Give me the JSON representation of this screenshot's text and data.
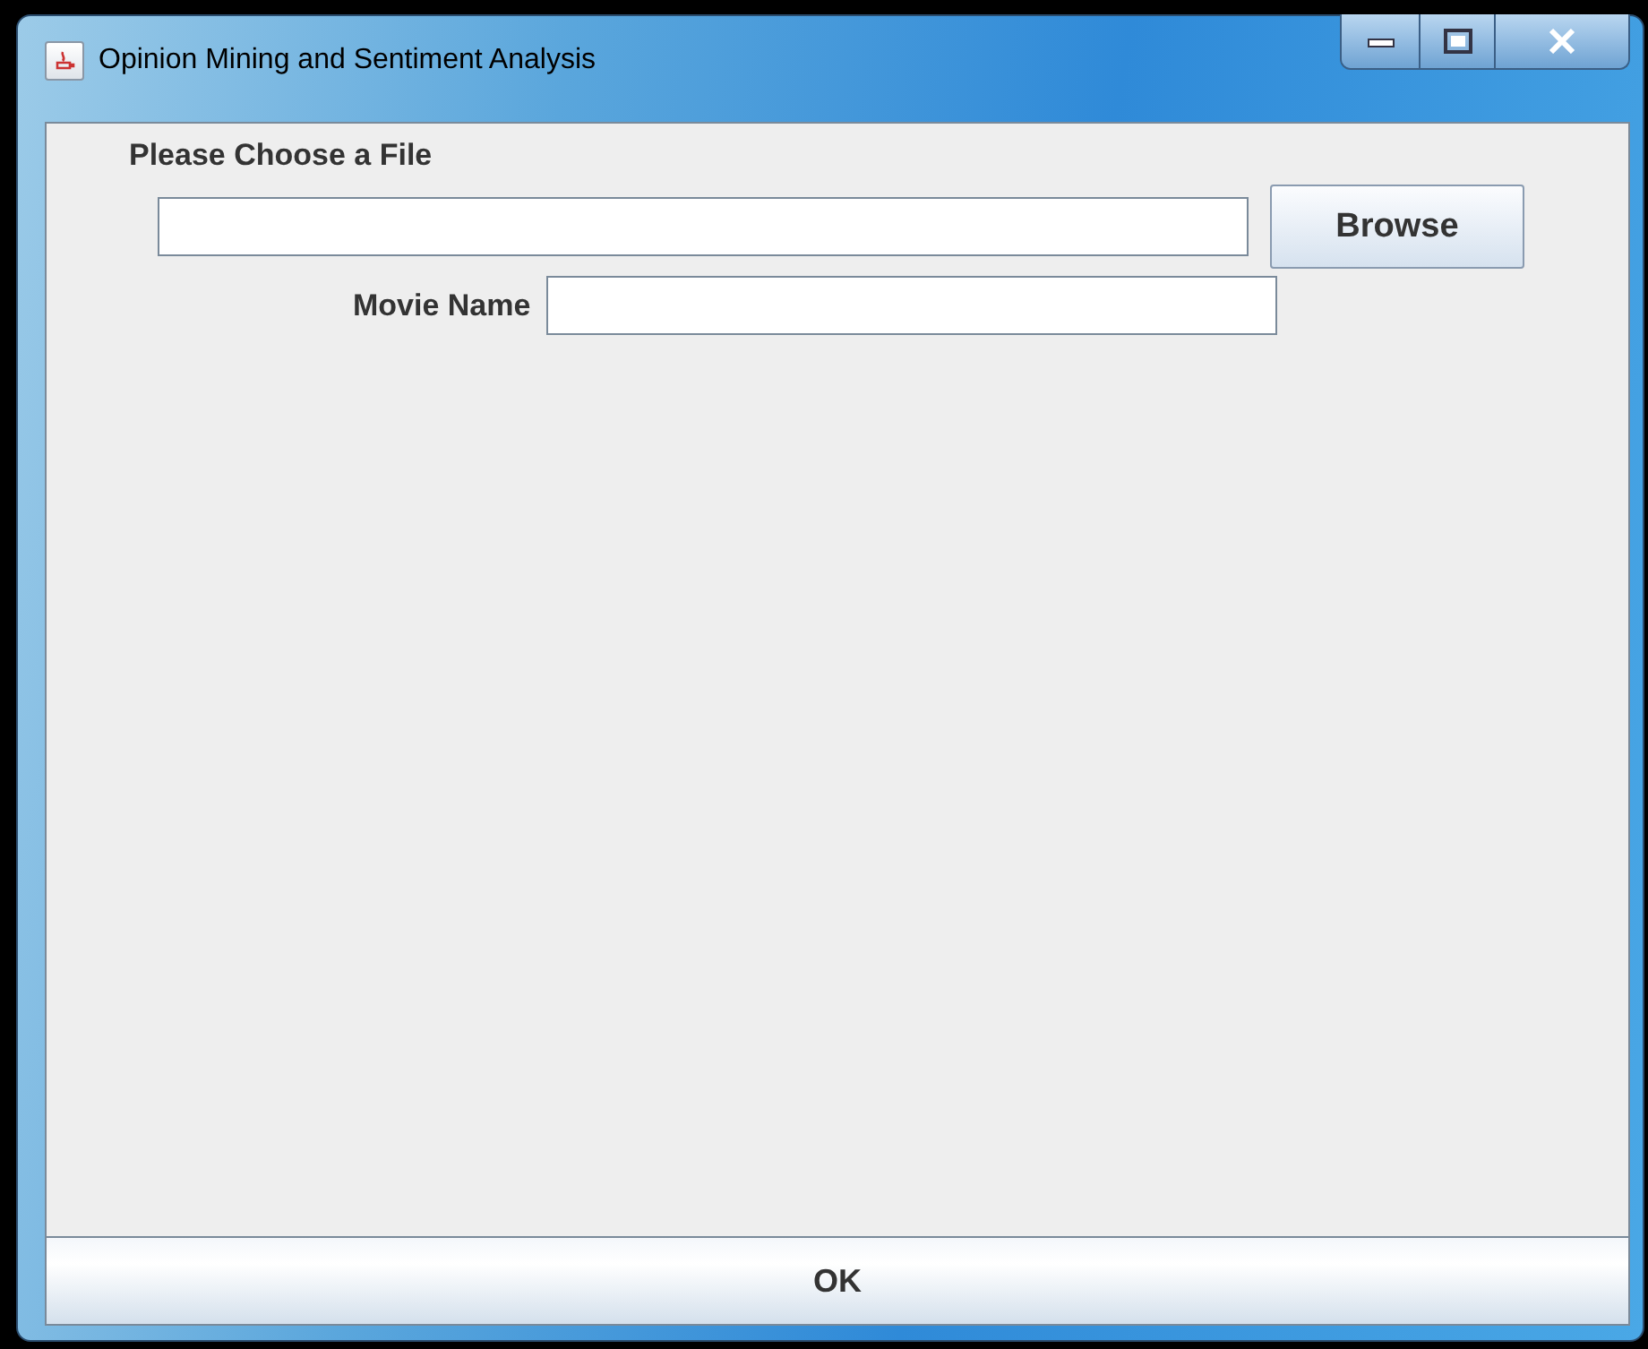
{
  "window": {
    "title": "Opinion Mining and Sentiment Analysis"
  },
  "file_label": "Please Choose a File",
  "browse_button": "Browse",
  "movie_name": {
    "label": "Movie Name"
  },
  "ok_button": "OK"
}
